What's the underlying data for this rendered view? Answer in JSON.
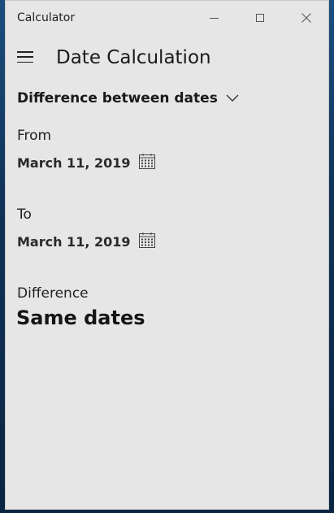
{
  "window": {
    "app_title": "Calculator"
  },
  "header": {
    "title": "Date Calculation"
  },
  "mode": {
    "selected": "Difference between dates"
  },
  "from": {
    "label": "From",
    "date": "March 11, 2019"
  },
  "to": {
    "label": "To",
    "date": "March 11, 2019"
  },
  "difference": {
    "label": "Difference",
    "value": "Same dates"
  },
  "icons": {
    "menu": "hamburger-icon",
    "dropdown": "chevron-down-icon",
    "calendar": "calendar-icon",
    "minimize": "minimize-icon",
    "maximize": "maximize-icon",
    "close": "close-icon"
  }
}
